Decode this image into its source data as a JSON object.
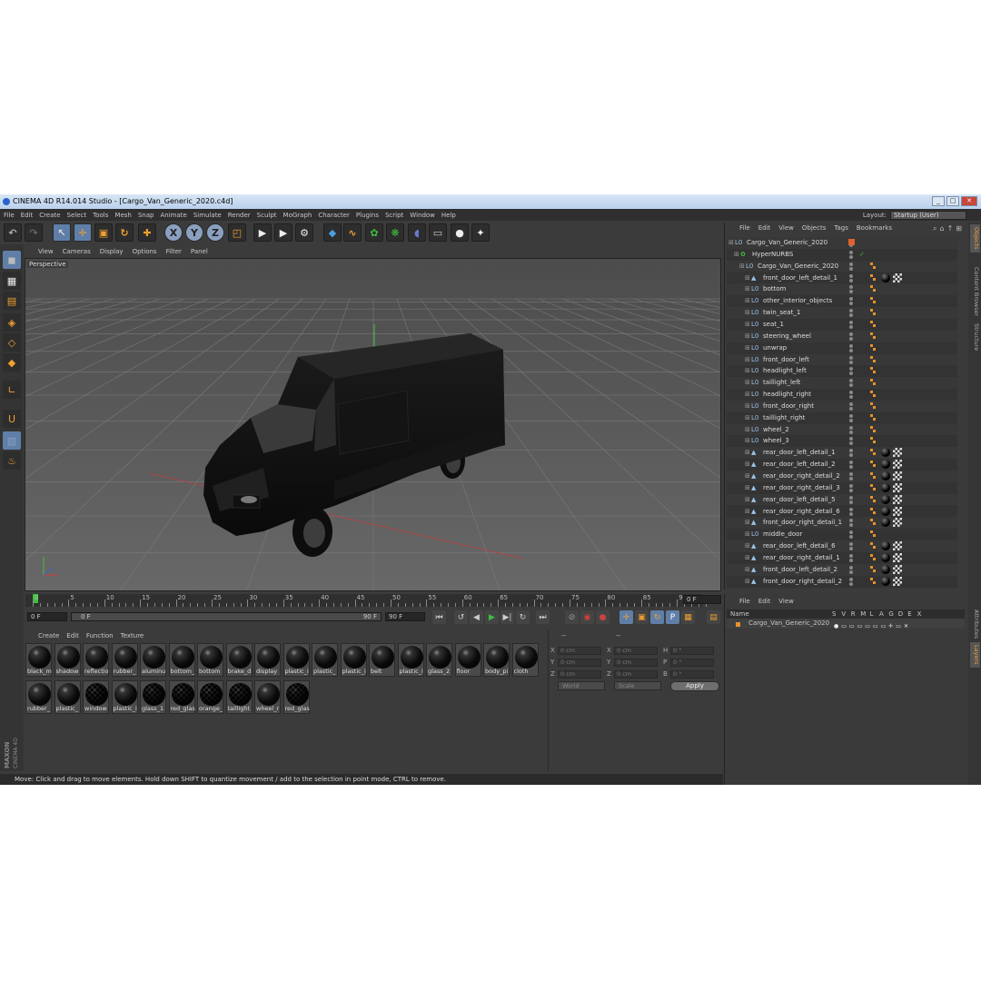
{
  "window": {
    "title": "CINEMA 4D R14.014 Studio - [Cargo_Van_Generic_2020.c4d]",
    "minimize": "_",
    "maximize": "□",
    "close": "✕"
  },
  "menu": [
    "File",
    "Edit",
    "Create",
    "Select",
    "Tools",
    "Mesh",
    "Snap",
    "Animate",
    "Simulate",
    "Render",
    "Sculpt",
    "MoGraph",
    "Character",
    "Plugins",
    "Script",
    "Window",
    "Help"
  ],
  "layout": {
    "label": "Layout:",
    "value": "Startup (User)"
  },
  "toolbar_icons": [
    {
      "name": "undo-icon",
      "glyph": "↶"
    },
    {
      "name": "redo-icon",
      "glyph": "↷"
    },
    {
      "name": "select-arrow-icon",
      "glyph": "↖"
    },
    {
      "name": "move-icon",
      "glyph": "✛"
    },
    {
      "name": "scale-icon",
      "glyph": "▣"
    },
    {
      "name": "rotate-icon",
      "glyph": "↻"
    },
    {
      "name": "add-icon",
      "glyph": "✚"
    },
    {
      "name": "x-axis-icon",
      "glyph": "X"
    },
    {
      "name": "y-axis-icon",
      "glyph": "Y"
    },
    {
      "name": "z-axis-icon",
      "glyph": "Z"
    },
    {
      "name": "coordinate-system-icon",
      "glyph": "◰"
    },
    {
      "name": "render-view-icon",
      "glyph": "▶"
    },
    {
      "name": "render-picture-viewer-icon",
      "glyph": "▶"
    },
    {
      "name": "render-settings-icon",
      "glyph": "⚙"
    },
    {
      "name": "cube-icon",
      "glyph": "◆"
    },
    {
      "name": "spline-icon",
      "glyph": "∿"
    },
    {
      "name": "nurbs-icon",
      "glyph": "✿"
    },
    {
      "name": "array-icon",
      "glyph": "❋"
    },
    {
      "name": "deformer-icon",
      "glyph": "◖"
    },
    {
      "name": "floor-icon",
      "glyph": "▭"
    },
    {
      "name": "camera-icon",
      "glyph": "●"
    },
    {
      "name": "light-icon",
      "glyph": "✦"
    }
  ],
  "left_tools": [
    "model-mode-icon",
    "texture-mode-icon",
    "workplane-icon",
    "points-mode-icon",
    "edges-mode-icon",
    "polygons-mode-icon",
    "axis-mode-icon",
    "magnet-icon",
    "snapping-icon",
    "sculpt-icon"
  ],
  "viewport": {
    "menu": [
      "View",
      "Cameras",
      "Display",
      "Options",
      "Filter",
      "Panel"
    ],
    "label": "Perspective"
  },
  "timeline": {
    "ticks": [
      "0",
      "5",
      "10",
      "15",
      "20",
      "25",
      "30",
      "35",
      "40",
      "45",
      "50",
      "55",
      "60",
      "65",
      "70",
      "75",
      "80",
      "85",
      "90"
    ],
    "current_frame": "0 F",
    "start": "0 F",
    "range_start": "0 F",
    "range_end": "90 F",
    "end": "90 F",
    "playback_glyphs": [
      "⏮",
      "↺",
      "◀",
      "▶",
      "▶|",
      "↻",
      "⏭"
    ]
  },
  "material_manager": {
    "menu": [
      "Create",
      "Edit",
      "Function",
      "Texture"
    ],
    "materials": [
      {
        "name": "black_m",
        "checker": false
      },
      {
        "name": "shadow",
        "checker": false
      },
      {
        "name": "reflectio",
        "checker": false
      },
      {
        "name": "rubber_",
        "checker": false
      },
      {
        "name": "aluminu",
        "checker": false
      },
      {
        "name": "bottom_",
        "checker": false
      },
      {
        "name": "bottom",
        "checker": false
      },
      {
        "name": "brake_d",
        "checker": false
      },
      {
        "name": "display",
        "checker": false
      },
      {
        "name": "plastic_i",
        "checker": false
      },
      {
        "name": "plastic_",
        "checker": false
      },
      {
        "name": "plastic_i",
        "checker": false
      },
      {
        "name": "belt",
        "checker": false
      },
      {
        "name": "plastic_i",
        "checker": false
      },
      {
        "name": "glass_2",
        "checker": false
      },
      {
        "name": "floor",
        "checker": false
      },
      {
        "name": "body_pi",
        "checker": false
      },
      {
        "name": "cloth",
        "checker": false
      },
      {
        "name": "rubber_",
        "checker": false
      },
      {
        "name": "plastic_",
        "checker": false
      },
      {
        "name": "window",
        "checker": true
      },
      {
        "name": "plastic_i",
        "checker": false
      },
      {
        "name": "glass_1",
        "checker": true
      },
      {
        "name": "red_glas",
        "checker": true
      },
      {
        "name": "orange_",
        "checker": true
      },
      {
        "name": "taillight",
        "checker": true
      },
      {
        "name": "wheel_r",
        "checker": false
      },
      {
        "name": "red_glas",
        "checker": true
      }
    ]
  },
  "coordinates": {
    "header_left": "--",
    "header_right": "--",
    "fields": [
      {
        "axis": "X",
        "value": "0 cm"
      },
      {
        "axis": "Y",
        "value": "0 cm"
      },
      {
        "axis": "Z",
        "value": "0 cm"
      },
      {
        "axis": "X",
        "value": "0 cm"
      },
      {
        "axis": "Y",
        "value": "0 cm"
      },
      {
        "axis": "Z",
        "value": "0 cm"
      },
      {
        "axis": "H",
        "value": "0 °"
      },
      {
        "axis": "P",
        "value": "0 °"
      },
      {
        "axis": "B",
        "value": "0 °"
      }
    ],
    "mode": "World",
    "scale": "Scale",
    "apply": "Apply"
  },
  "status": "Move: Click and drag to move elements. Hold down SHIFT to quantize movement / add to the selection in point mode, CTRL to remove.",
  "object_manager": {
    "menu": [
      "File",
      "Edit",
      "View",
      "Objects",
      "Tags",
      "Bookmarks"
    ],
    "objects": [
      {
        "name": "Cargo_Van_Generic_2020",
        "depth": 0,
        "icon": "L0",
        "tags": ""
      },
      {
        "name": "HyperNURBS",
        "depth": 1,
        "icon": "✿",
        "tags": ""
      },
      {
        "name": "Cargo_Van_Generic_2020",
        "depth": 2,
        "icon": "L0",
        "tags": ""
      },
      {
        "name": "front_door_left_detail_1",
        "depth": 3,
        "icon": "▲",
        "tags": "mc"
      },
      {
        "name": "bottom",
        "depth": 3,
        "icon": "L0",
        "tags": ""
      },
      {
        "name": "other_interior_objects",
        "depth": 3,
        "icon": "L0",
        "tags": ""
      },
      {
        "name": "twin_seat_1",
        "depth": 3,
        "icon": "L0",
        "tags": ""
      },
      {
        "name": "seat_1",
        "depth": 3,
        "icon": "L0",
        "tags": ""
      },
      {
        "name": "steering_wheel",
        "depth": 3,
        "icon": "L0",
        "tags": ""
      },
      {
        "name": "unwrap",
        "depth": 3,
        "icon": "L0",
        "tags": ""
      },
      {
        "name": "front_door_left",
        "depth": 3,
        "icon": "L0",
        "tags": ""
      },
      {
        "name": "headlight_left",
        "depth": 3,
        "icon": "L0",
        "tags": ""
      },
      {
        "name": "taillight_left",
        "depth": 3,
        "icon": "L0",
        "tags": ""
      },
      {
        "name": "headlight_right",
        "depth": 3,
        "icon": "L0",
        "tags": ""
      },
      {
        "name": "front_door_right",
        "depth": 3,
        "icon": "L0",
        "tags": ""
      },
      {
        "name": "taillight_right",
        "depth": 3,
        "icon": "L0",
        "tags": ""
      },
      {
        "name": "wheel_2",
        "depth": 3,
        "icon": "L0",
        "tags": ""
      },
      {
        "name": "wheel_3",
        "depth": 3,
        "icon": "L0",
        "tags": ""
      },
      {
        "name": "rear_door_left_detail_1",
        "depth": 3,
        "icon": "▲",
        "tags": "mc"
      },
      {
        "name": "rear_door_left_detail_2",
        "depth": 3,
        "icon": "▲",
        "tags": "mc"
      },
      {
        "name": "rear_door_right_detail_2",
        "depth": 3,
        "icon": "▲",
        "tags": "mc"
      },
      {
        "name": "rear_door_right_detail_3",
        "depth": 3,
        "icon": "▲",
        "tags": "mc"
      },
      {
        "name": "rear_door_left_detail_5",
        "depth": 3,
        "icon": "▲",
        "tags": "mc"
      },
      {
        "name": "rear_door_right_detail_6",
        "depth": 3,
        "icon": "▲",
        "tags": "mc"
      },
      {
        "name": "front_door_right_detail_1",
        "depth": 3,
        "icon": "▲",
        "tags": "mc"
      },
      {
        "name": "middle_door",
        "depth": 3,
        "icon": "L0",
        "tags": ""
      },
      {
        "name": "rear_door_left_detail_6",
        "depth": 3,
        "icon": "▲",
        "tags": "mc"
      },
      {
        "name": "rear_door_right_detail_1",
        "depth": 3,
        "icon": "▲",
        "tags": "mc"
      },
      {
        "name": "front_door_left_detail_2",
        "depth": 3,
        "icon": "▲",
        "tags": "mc"
      },
      {
        "name": "front_door_right_detail_2",
        "depth": 3,
        "icon": "▲",
        "tags": "mc"
      }
    ]
  },
  "side_tabs": [
    "Objects",
    "Content Browser",
    "Structure"
  ],
  "side_tabs_lower": [
    "Attributes",
    "Layers"
  ],
  "layer_manager": {
    "menu": [
      "File",
      "Edit",
      "View"
    ],
    "columns": [
      "Name",
      "S",
      "V",
      "R",
      "M",
      "L",
      "A",
      "G",
      "D",
      "E",
      "X"
    ],
    "row": "Cargo_Van_Generic_2020"
  },
  "brand": {
    "line1": "MAXON",
    "line2": "CINEMA 4D"
  },
  "colors": {
    "accent": "#5f7fa8",
    "tag_orange": "#e8922a",
    "axis_green": "#3fbf3f",
    "axis_red": "#c84040"
  }
}
